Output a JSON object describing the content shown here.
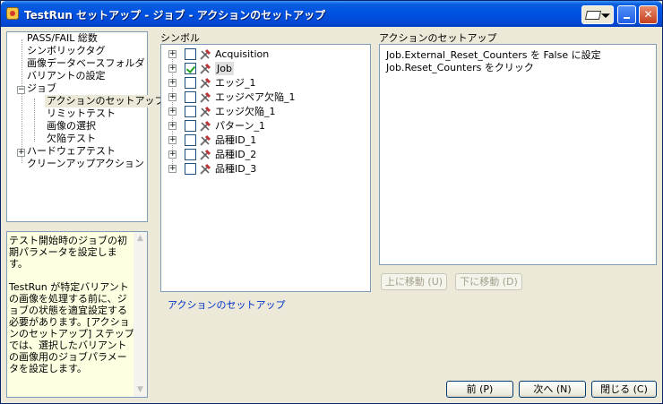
{
  "window": {
    "title": "TestRun セットアップ - ジョブ - アクションのセットアップ"
  },
  "nav_tree": [
    {
      "label": "PASS/FAIL 総数"
    },
    {
      "label": "シンボリックタグ"
    },
    {
      "label": "画像データベースフォルダ"
    },
    {
      "label": "バリアントの設定"
    },
    {
      "label": "ジョブ",
      "expanded": true
    },
    {
      "label": "アクションのセットアップ",
      "selected": true
    },
    {
      "label": "リミットテスト"
    },
    {
      "label": "画像の選択"
    },
    {
      "label": "欠陥テスト"
    },
    {
      "label": "ハードウェアテスト",
      "expanded": false
    },
    {
      "label": "クリーンアップアクション"
    }
  ],
  "help": {
    "text": "テスト開始時のジョブの初期パラメータを設定します。\n\nTestRun が特定バリアントの画像を処理する前に、ジョブの状態を適宜設定する必要があります。[アクションのセットアップ] ステップでは、選択したバリアントの画像用のジョブパラメータを設定します。"
  },
  "symbols": {
    "label": "シンボル",
    "items": [
      {
        "label": "Acquisition",
        "checked": false
      },
      {
        "label": "Job",
        "checked": true,
        "selected": true
      },
      {
        "label": "エッジ_1",
        "checked": false
      },
      {
        "label": "エッジペア欠陥_1",
        "checked": false
      },
      {
        "label": "エッジ欠陥_1",
        "checked": false
      },
      {
        "label": "パターン_1",
        "checked": false
      },
      {
        "label": "品種ID_1",
        "checked": false
      },
      {
        "label": "品種ID_2",
        "checked": false
      },
      {
        "label": "品種ID_3",
        "checked": false
      }
    ]
  },
  "actions": {
    "label": "アクションのセットアップ",
    "lines": [
      "Job.External_Reset_Counters を False に設定",
      "Job.Reset_Counters をクリック"
    ],
    "move_up_label": "上に移動 (U)",
    "move_down_label": "下に移動 (D)"
  },
  "link_label": "アクションのセットアップ",
  "footer": {
    "back_label": "前 (P)",
    "next_label": "次へ (N)",
    "close_label": "閉じる (C)"
  }
}
